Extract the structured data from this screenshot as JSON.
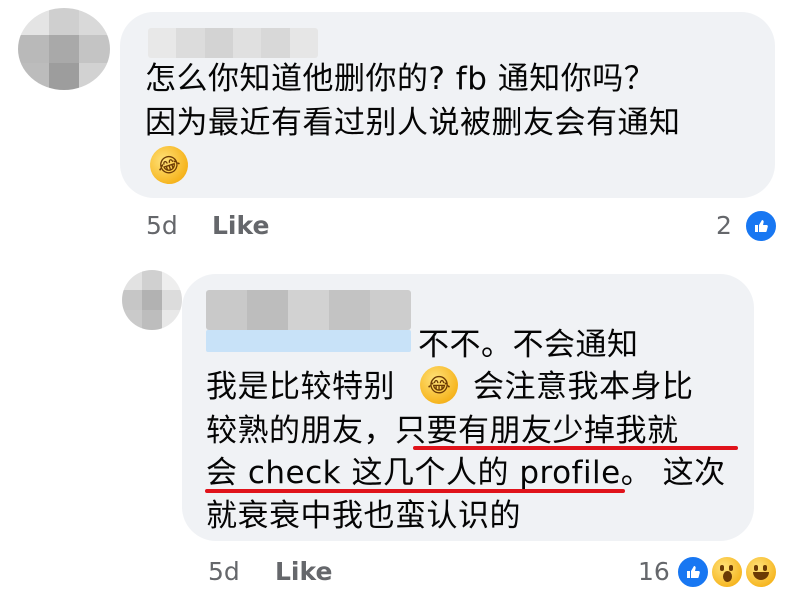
{
  "comment_1": {
    "lines": [
      "怎么你知道他删你的? fb 通知你吗？",
      "因为最近有看过别人说被删友会有通知"
    ],
    "time": "5d",
    "like_label": "Like",
    "reaction_count": "2",
    "reactions": [
      "like-icon"
    ]
  },
  "reply_1": {
    "lines": [
      "不不。不会通知",
      "我是比较特别",
      "会注意我本身比",
      "较熟的朋友，只要有朋友少掉我就",
      "会 check 这几个人的 profile。 这次",
      "就衰衰中我也蛮认识的"
    ],
    "time": "5d",
    "like_label": "Like",
    "reaction_count": "16",
    "reactions": [
      "like-icon",
      "wow-icon",
      "haha-icon"
    ]
  },
  "colors": {
    "bubble_bg": "#f0f2f5",
    "text": "#050505",
    "meta_text": "#65676b",
    "like_blue": "#1877f2",
    "underline_red": "#e0131b"
  }
}
